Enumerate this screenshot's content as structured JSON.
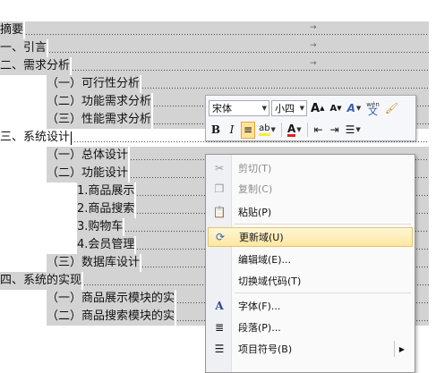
{
  "toc": [
    {
      "text": "摘要",
      "indent": 0,
      "hl": true,
      "tab": true
    },
    {
      "text": "一、引言",
      "indent": 0,
      "hl": true,
      "tab": true
    },
    {
      "text": "二、需求分析",
      "indent": 0,
      "hl": true,
      "tab": true
    },
    {
      "text": "（一）可行性分析",
      "indent": 52,
      "hl": true
    },
    {
      "text": "（二）功能需求分析",
      "indent": 52,
      "hl": true
    },
    {
      "text": "（三）性能需求分析",
      "indent": 52,
      "hl": true
    },
    {
      "text": "三、系统设计",
      "indent": 0,
      "hl": false,
      "caret": true
    },
    {
      "text": "（一）总体设计",
      "indent": 52,
      "hl": true
    },
    {
      "text": "（二）功能设计",
      "indent": 52,
      "hl": true
    },
    {
      "text": "1.商品展示",
      "indent": 86,
      "hl": true
    },
    {
      "text": "2.商品搜索",
      "indent": 86,
      "hl": true
    },
    {
      "text": "3.购物车",
      "indent": 86,
      "hl": true
    },
    {
      "text": "4.会员管理",
      "indent": 86,
      "hl": true
    },
    {
      "text": "（三）数据库设计",
      "indent": 52,
      "hl": true
    },
    {
      "text": "四、系统的实现",
      "indent": 0,
      "hl": true
    },
    {
      "text": "（一）商品展示模块的实",
      "indent": 52,
      "hl": true
    },
    {
      "text": "（二）商品搜索模块的实",
      "indent": 52,
      "hl": true
    }
  ],
  "toolbar": {
    "font": "宋体",
    "size": "小四",
    "grow": "A",
    "shrink": "A",
    "bold": "B",
    "italic": "I",
    "highlight": "ab",
    "color": "A",
    "wen": "wén",
    "wen_char": "文"
  },
  "menu": [
    {
      "label": "剪切(T)",
      "icon": "cut-icon",
      "glyph": "✂",
      "disabled": true
    },
    {
      "label": "复制(C)",
      "icon": "copy-icon",
      "glyph": "❐",
      "disabled": true
    },
    {
      "label": "粘贴(P)",
      "icon": "paste-icon",
      "glyph": "📋",
      "disabled": false
    },
    {
      "label": "更新域(U)",
      "icon": "update-field-icon",
      "glyph": "⟳",
      "disabled": false,
      "hover": true
    },
    {
      "label": "编辑域(E)...",
      "icon": "",
      "glyph": "",
      "disabled": false
    },
    {
      "label": "切换域代码(T)",
      "icon": "",
      "glyph": "",
      "disabled": false
    },
    {
      "label": "字体(F)...",
      "icon": "font-icon",
      "glyph": "A",
      "disabled": false
    },
    {
      "label": "段落(P)...",
      "icon": "paragraph-icon",
      "glyph": "≣",
      "disabled": false
    },
    {
      "label": "项目符号(B)",
      "icon": "bullets-icon",
      "glyph": "☰",
      "disabled": false,
      "submenu": true
    }
  ],
  "colors": {
    "highlight": "#d3d3d3",
    "menu_hover": "#ffe7a1",
    "active_btn": "#ffe39a",
    "font_color": "#e02020",
    "highlight_color": "#f5ee3a"
  }
}
